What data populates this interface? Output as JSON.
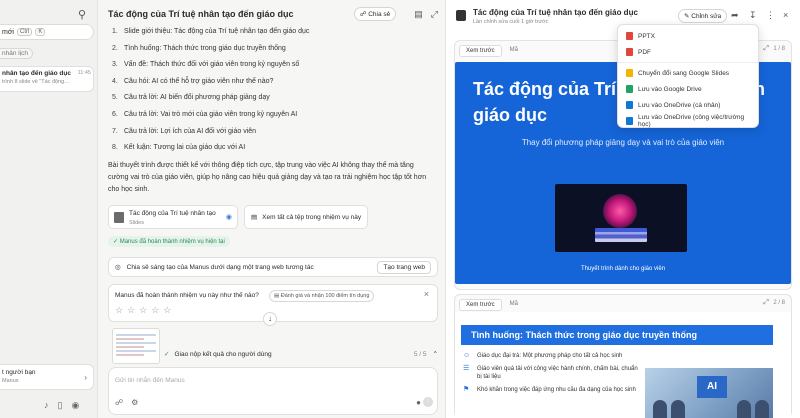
{
  "sidebar": {
    "new_task": "mới",
    "shortcut_ctrl": "Ctrl",
    "shortcut_key": "K",
    "tag": "nhân lịch",
    "task_title": "nhân tạo đến giáo dục",
    "task_time": "11:45",
    "task_sub": "trình 8 slide về \"Tác động...",
    "user_name": "t người bạn",
    "user_sub": "Manus"
  },
  "chat": {
    "title": "Tác động của Trí tuệ nhân tạo đến giáo dục",
    "share_label": "Chia sẻ",
    "slides": [
      {
        "num": "1.",
        "text": "Slide giới thiệu: Tác động của Trí tuệ nhân tạo đến giáo dục"
      },
      {
        "num": "2.",
        "text": "Tình huống: Thách thức trong giáo dục truyền thống"
      },
      {
        "num": "3.",
        "text": "Vấn đề: Thách thức đối với giáo viên trong kỷ nguyên số"
      },
      {
        "num": "4.",
        "text": "Câu hỏi: AI có thể hỗ trợ giáo viên như thế nào?"
      },
      {
        "num": "5.",
        "text": "Câu trả lời: AI biến đổi phương pháp giảng dạy"
      },
      {
        "num": "6.",
        "text": "Câu trả lời: Vai trò mới của giáo viên trong kỷ nguyên AI"
      },
      {
        "num": "7.",
        "text": "Câu trả lời: Lợi ích của AI đối với giáo viên"
      },
      {
        "num": "8.",
        "text": "Kết luận: Tương lai của giáo dục với AI"
      }
    ],
    "summary": "Bài thuyết trình được thiết kế với thông điệp tích cực, tập trung vào việc AI không thay thế mà tăng cường vai trò của giáo viên, giúp họ nâng cao hiệu quả giảng dạy và tạo ra trải nghiệm học tập tốt hơn cho học sinh.",
    "file_title": "Tác động của Trí tuệ nhân tạo ...",
    "file_type": "Slides",
    "view_all": "Xem tất cả tệp trong nhiệm vụ này",
    "done_badge": "Manus đã hoàn thành nhiệm vụ hiện tại",
    "share_web": "Chia sẻ sáng tạo của Manus dưới dạng một trang web tương tác",
    "create_web": "Tạo trang web",
    "rating_question": "Manus đã hoàn thành nhiệm vụ này như thế nào?",
    "rating_reward": "Đánh giá và nhận 100 điểm tín dụng",
    "task_step": "Giao nộp kết quả cho người dùng",
    "task_count": "5 / 5",
    "placeholder": "Gửi tin nhắn đến Manus"
  },
  "preview": {
    "title": "Tác động của Trí tuệ nhân tạo đến giáo dục",
    "subtitle": "Lần chỉnh sửa cuối 1 giờ trước",
    "edit_label": "Chỉnh sửa",
    "tab_preview": "Xem trước",
    "tab_code": "Mã",
    "slide1": {
      "count": "1 / 8",
      "title": "Tác động của Trí tuệ nhân tạo đến giáo dục",
      "subtitle": "Thay đổi phương pháp giảng dạy và vai trò của giáo viên",
      "caption": "Thuyết trình dành cho giáo viên"
    },
    "slide2": {
      "count": "2 / 8",
      "title": "Tình huống: Thách thức trong giáo dục truyền thống",
      "items": [
        "Giáo dục đại trà: Một phương pháp cho tất cả học sinh",
        "Giáo viên quá tải với công việc hành chính, chấm bài, chuẩn bị tài liệu",
        "Khó khăn trong việc đáp ứng nhu cầu đa dạng của học sinh"
      ],
      "photo_text": "AI"
    }
  },
  "export_menu": {
    "items": [
      {
        "label": "PPTX",
        "color": "#e0463b"
      },
      {
        "label": "PDF",
        "color": "#e0463b"
      },
      {
        "label": "Chuyển đổi sang Google Slides",
        "color": "#f4b400"
      },
      {
        "label": "Lưu vào Google Drive",
        "color": "#1fa463"
      },
      {
        "label": "Lưu vào OneDrive (cá nhân)",
        "color": "#0f78d4"
      },
      {
        "label": "Lưu vào OneDrive (công việc/trường học)",
        "color": "#0f78d4"
      }
    ]
  }
}
